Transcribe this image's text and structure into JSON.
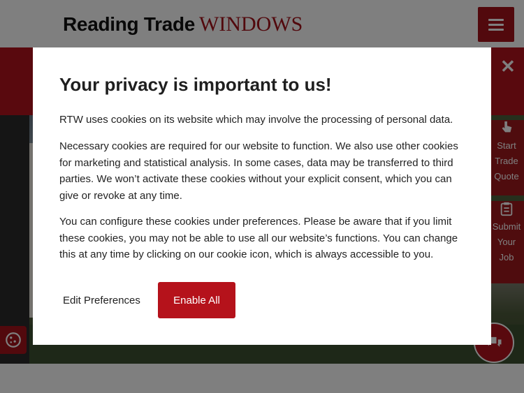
{
  "header": {
    "logo_part1": "Reading Trade",
    "logo_part2": "WINDOWS",
    "menu_icon": "hamburger-menu-icon"
  },
  "promo": {
    "close_label": "✕",
    "close_icon": "close-icon"
  },
  "side_tabs": [
    {
      "label_lines": [
        "Start",
        "Trade",
        "Quote"
      ],
      "icon": "hand-pointer-icon"
    },
    {
      "label_lines": [
        "Submit",
        "Your",
        "Job"
      ],
      "icon": "clipboard-icon"
    }
  ],
  "floating": {
    "cookie_icon": "cookie-icon",
    "chat_icon": "chat-bubbles-icon"
  },
  "modal": {
    "title": "Your privacy is important to us!",
    "paragraphs": [
      "RTW uses cookies on its website which may involve the processing of personal data.",
      "Necessary cookies are required for our website to function. We also use other cookies for marketing and statistical analysis. In some cases, data may be transferred to third parties. We won’t activate these cookies without your explicit consent, which you can give or revoke at any time.",
      "You can configure these cookies under preferences. Please be aware that if you limit these cookies, you may not be able to use all our website’s functions. You can change this at any time by clicking on our cookie icon, which is always accessible to you."
    ],
    "edit_preferences_label": "Edit Preferences",
    "enable_all_label": "Enable All"
  },
  "colors": {
    "brand_red": "#a5121b",
    "button_red": "#b5121b",
    "overlay": "rgba(0,0,0,0.5)"
  }
}
